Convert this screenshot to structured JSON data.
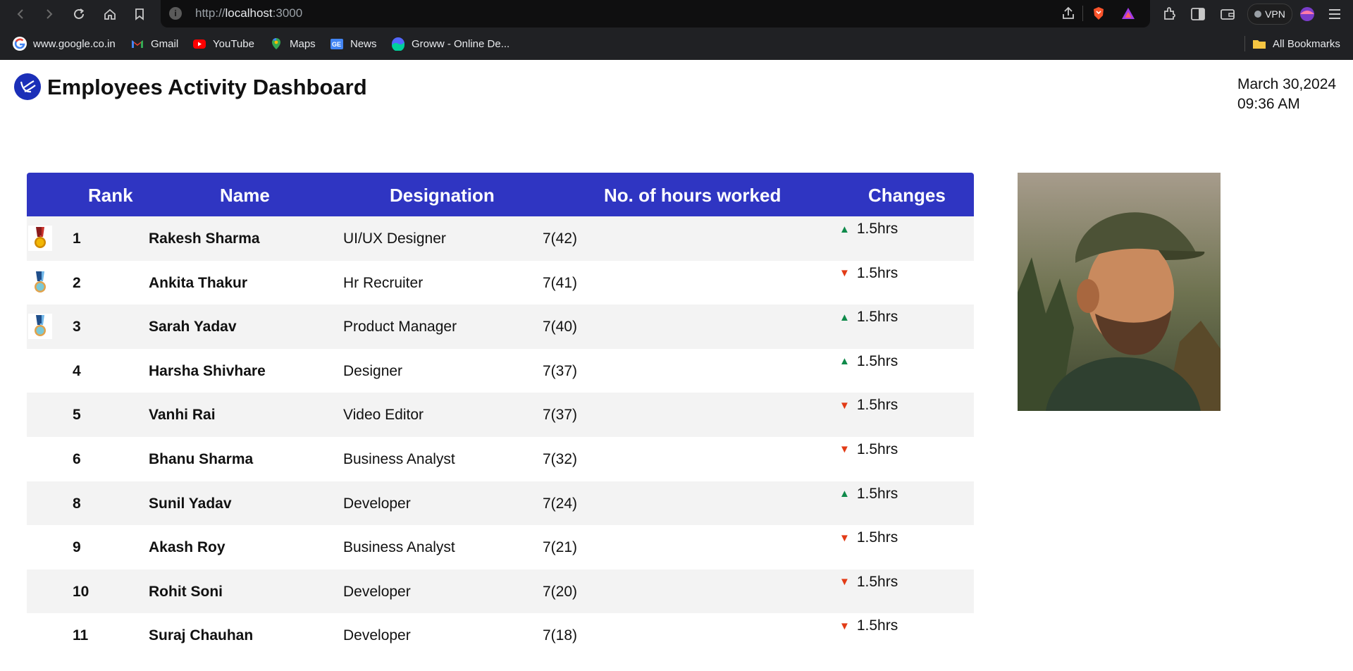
{
  "browser": {
    "url_prefix": "http://",
    "url_host": "localhost",
    "url_suffix": ":3000",
    "vpn_label": "VPN",
    "bookmarks": [
      {
        "label": "www.google.co.in",
        "icon": "google-icon"
      },
      {
        "label": "Gmail",
        "icon": "gmail-icon"
      },
      {
        "label": "YouTube",
        "icon": "youtube-icon"
      },
      {
        "label": "Maps",
        "icon": "maps-icon"
      },
      {
        "label": "News",
        "icon": "news-icon"
      },
      {
        "label": "Groww - Online De...",
        "icon": "groww-icon"
      }
    ],
    "all_bookmarks_label": "All Bookmarks"
  },
  "header": {
    "title": "Employees Activity Dashboard",
    "date": "March 30,2024",
    "time": "09:36 AM"
  },
  "table": {
    "columns": [
      "Rank",
      "Name",
      "Designation",
      "No. of hours worked",
      "Changes"
    ],
    "rows": [
      {
        "rank": "1",
        "name": "Rakesh Sharma",
        "designation": "UI/UX Designer",
        "hours": "7(42)",
        "change": "1.5hrs",
        "trend": "up",
        "medal": "gold-medal-icon"
      },
      {
        "rank": "2",
        "name": "Ankita Thakur",
        "designation": "Hr Recruiter",
        "hours": "7(41)",
        "change": "1.5hrs",
        "trend": "down",
        "medal": "silver-medal-icon"
      },
      {
        "rank": "3",
        "name": "Sarah Yadav",
        "designation": "Product Manager",
        "hours": "7(40)",
        "change": "1.5hrs",
        "trend": "up",
        "medal": "bronze-medal-icon"
      },
      {
        "rank": "4",
        "name": "Harsha Shivhare",
        "designation": "Designer",
        "hours": "7(37)",
        "change": "1.5hrs",
        "trend": "up",
        "medal": ""
      },
      {
        "rank": "5",
        "name": "Vanhi Rai",
        "designation": "Video Editor",
        "hours": "7(37)",
        "change": "1.5hrs",
        "trend": "down",
        "medal": ""
      },
      {
        "rank": "6",
        "name": "Bhanu Sharma",
        "designation": "Business Analyst",
        "hours": "7(32)",
        "change": "1.5hrs",
        "trend": "down",
        "medal": ""
      },
      {
        "rank": "8",
        "name": "Sunil Yadav",
        "designation": "Developer",
        "hours": "7(24)",
        "change": "1.5hrs",
        "trend": "up",
        "medal": ""
      },
      {
        "rank": "9",
        "name": "Akash Roy",
        "designation": "Business Analyst",
        "hours": "7(21)",
        "change": "1.5hrs",
        "trend": "down",
        "medal": ""
      },
      {
        "rank": "10",
        "name": "Rohit Soni",
        "designation": "Developer",
        "hours": "7(20)",
        "change": "1.5hrs",
        "trend": "down",
        "medal": ""
      },
      {
        "rank": "11",
        "name": "Suraj Chauhan",
        "designation": "Developer",
        "hours": "7(18)",
        "change": "1.5hrs",
        "trend": "down",
        "medal": ""
      }
    ]
  },
  "colors": {
    "header_bg": "#2f35c2",
    "row_alt": "#f3f3f3",
    "up": "#0f8a4a",
    "down": "#e23b16"
  }
}
